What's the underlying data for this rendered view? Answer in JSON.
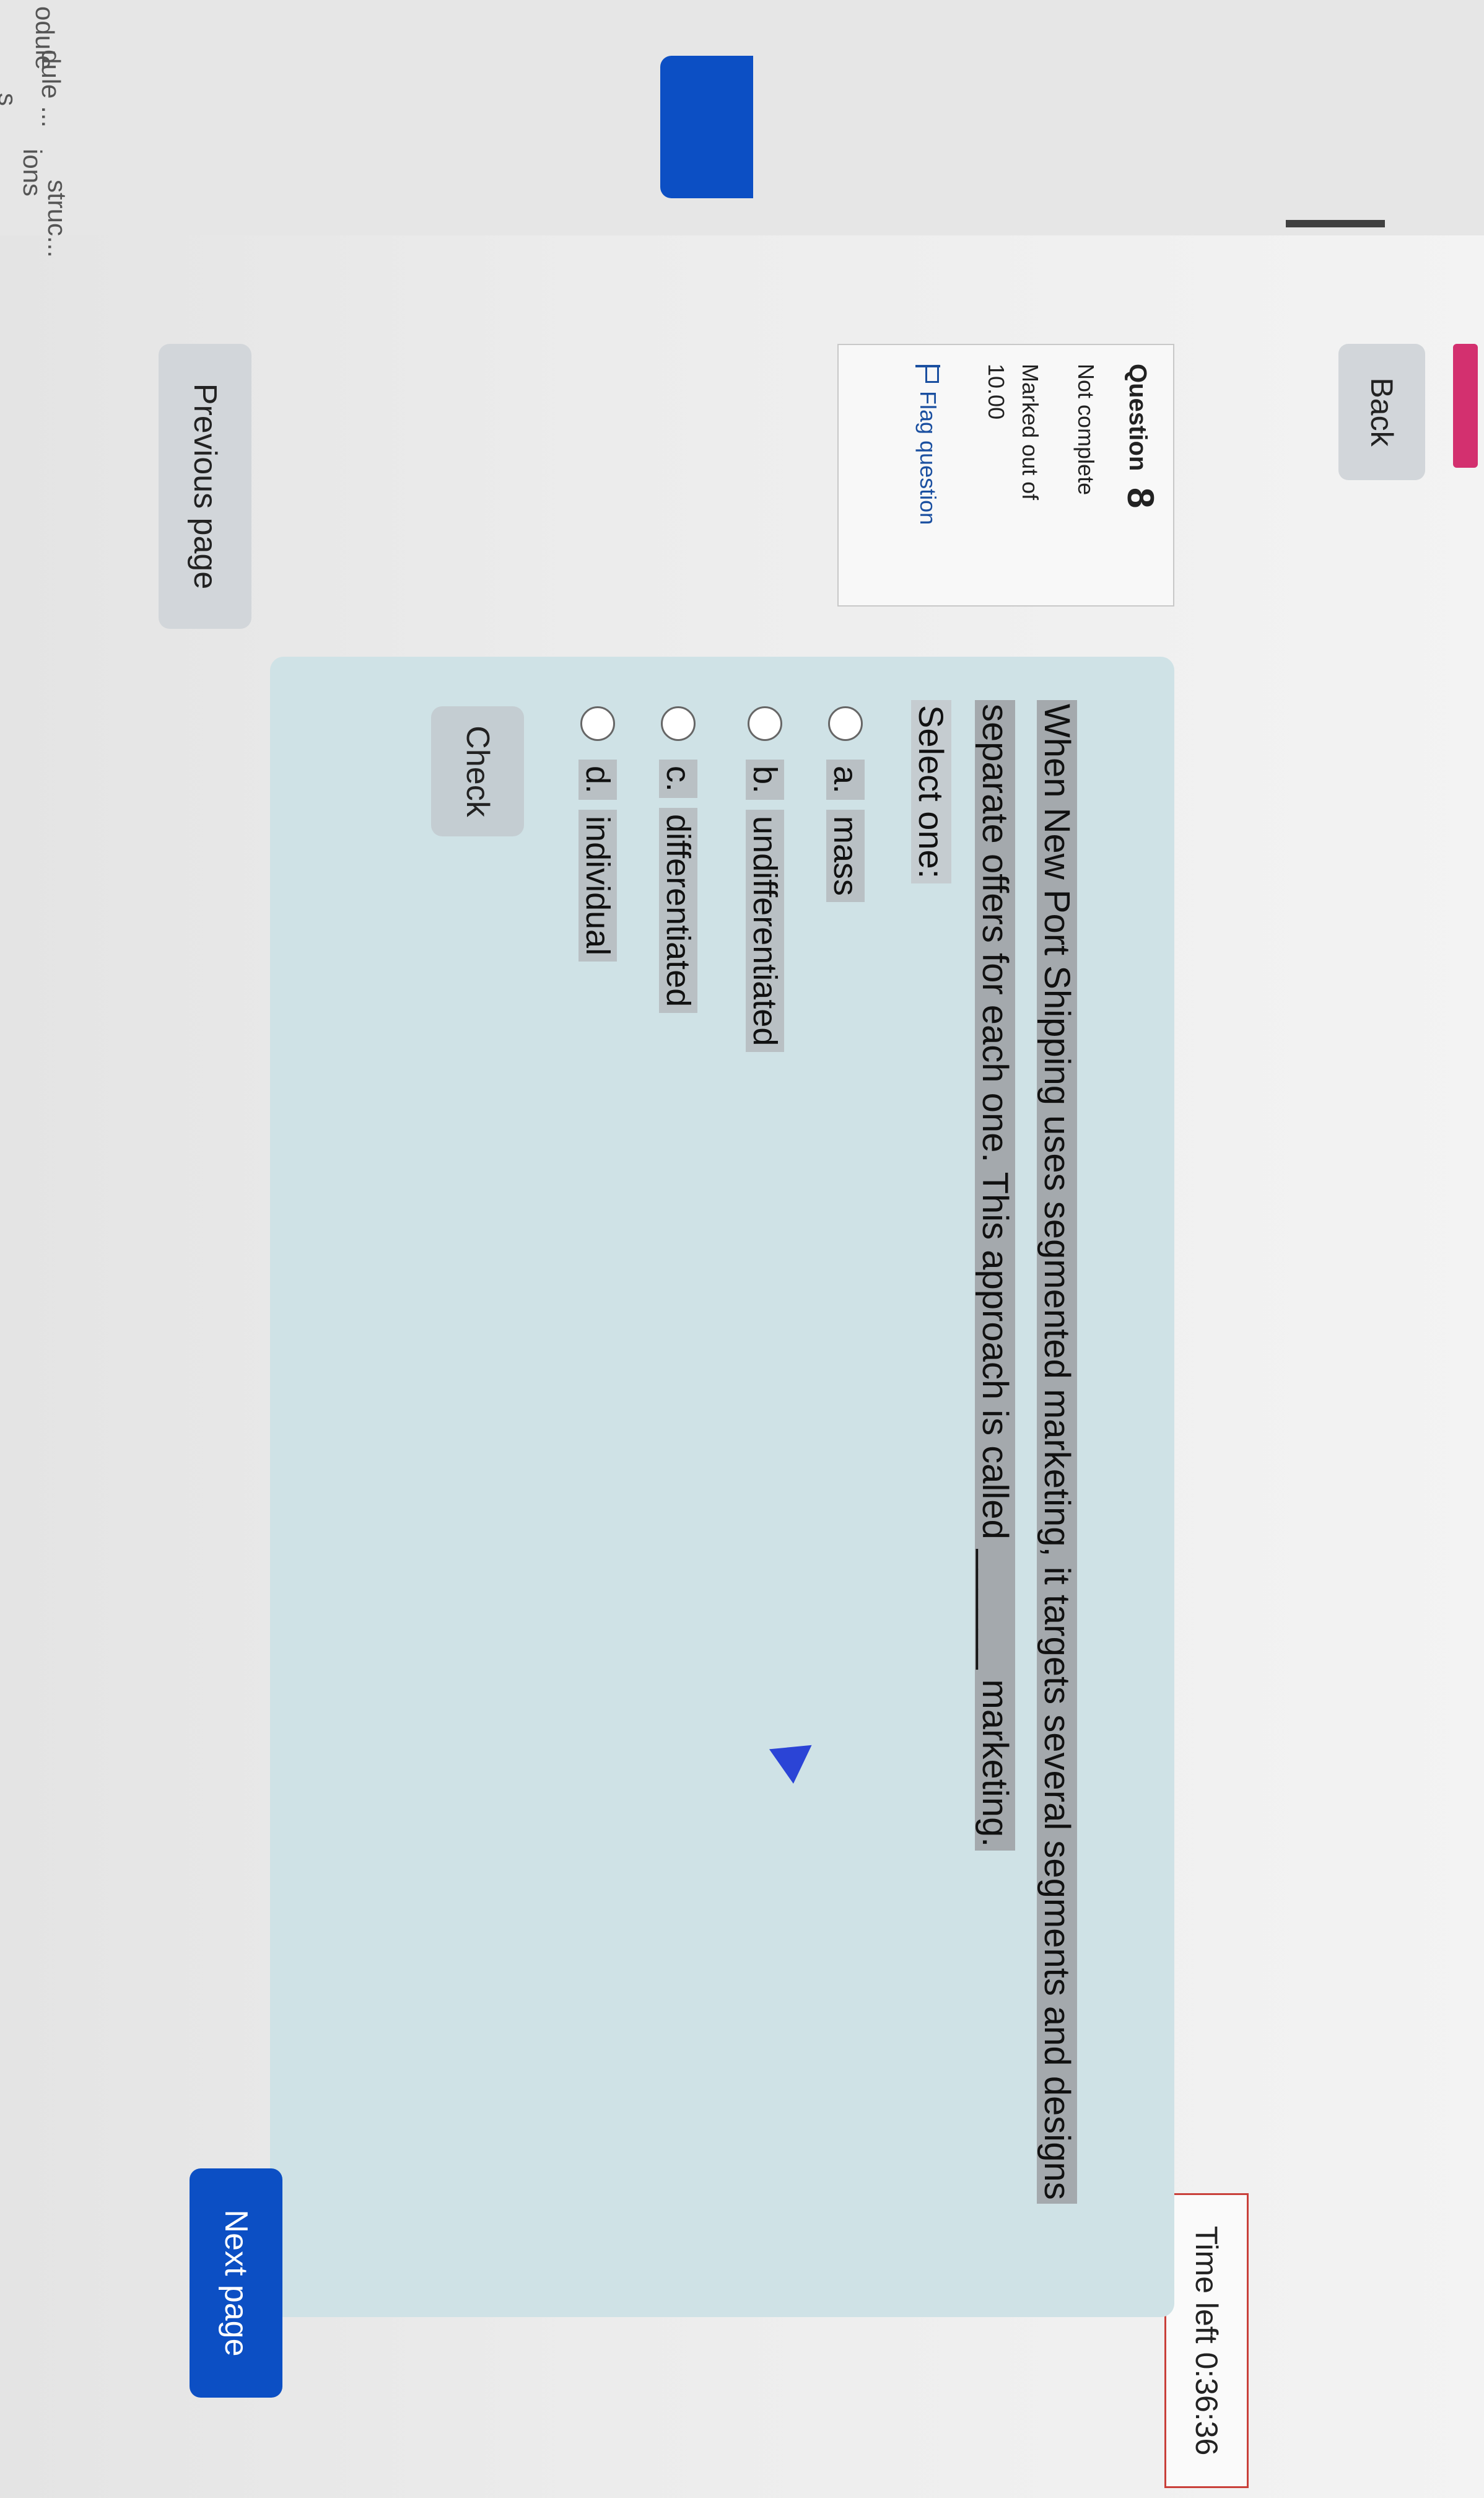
{
  "sidebar": {
    "items": [
      "odule",
      "dule ...",
      "s",
      "ions",
      "struc..."
    ]
  },
  "nav": {
    "back_label": "Back",
    "timer_text": "Time left 0:36:36"
  },
  "question_info": {
    "label": "Question",
    "number": "8",
    "status": "Not complete",
    "marked_label": "Marked out of",
    "points": "10.00",
    "flag_label": "Flag question"
  },
  "question": {
    "text_line1": "When New Port Shipping uses segmented marketing, it targets several segments and designs",
    "text_line2": "separate offers for each one. This approach is called ______ marketing.",
    "select_label": "Select one:",
    "options": [
      {
        "letter": "a.",
        "text": "mass"
      },
      {
        "letter": "b.",
        "text": "undifferentiated"
      },
      {
        "letter": "c.",
        "text": "differentiated"
      },
      {
        "letter": "d.",
        "text": "individual"
      }
    ],
    "check_label": "Check"
  },
  "footer": {
    "prev_label": "Previous page",
    "next_label": "Next page"
  },
  "colors": {
    "primary_blue": "#0c4fc4",
    "card_background": "#cfe2e6",
    "timer_border": "#c9403a"
  }
}
